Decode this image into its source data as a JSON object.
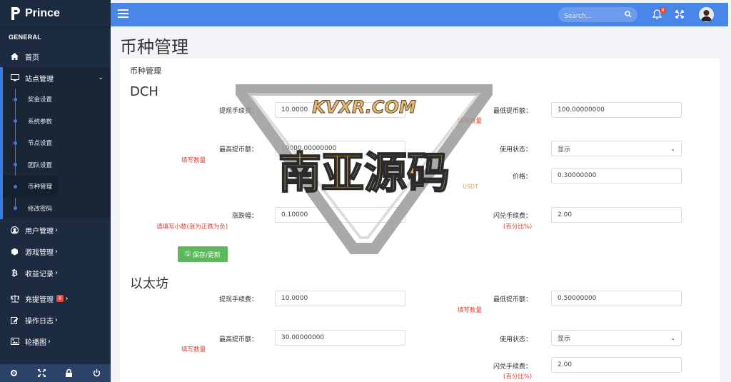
{
  "brand": {
    "name": "Prince"
  },
  "sidebar": {
    "section": "GENERAL",
    "home": "首页",
    "site_manage": "站点管理",
    "sub_items": [
      "奖金设置",
      "系统参数",
      "节点设置",
      "团队设置",
      "币种管理",
      "修改密码"
    ],
    "items": [
      {
        "label": "用户管理",
        "icon": "user-icon"
      },
      {
        "label": "游戏管理",
        "icon": "cube-icon"
      },
      {
        "label": "收益记录",
        "icon": "bitcoin-icon"
      },
      {
        "label": "充提管理",
        "icon": "scale-icon",
        "badge": "8"
      },
      {
        "label": "操作日志",
        "icon": "edit-icon"
      },
      {
        "label": "轮播图",
        "icon": "image-icon"
      }
    ]
  },
  "topbar": {
    "search_placeholder": "Search...",
    "notifications": "8"
  },
  "page": {
    "title": "币种管理",
    "card_title": "币种管理"
  },
  "coins": [
    {
      "name": "DCH",
      "withdraw_fee_label": "提现手续费：",
      "withdraw_fee": "10.0000",
      "min_withdraw_label": "最低提币额：",
      "min_withdraw": "100.00000000",
      "max_withdraw_label": "最高提币额：",
      "max_withdraw": "10000.00000000",
      "status_label": "使用状态：",
      "status": "显示",
      "price_label": "价格：",
      "price": "0.30000000",
      "change_label": "涨跌幅：",
      "change": "0.10000",
      "swap_fee_label": "闪兑手续费：",
      "swap_fee": "2.00",
      "save_label": "保存/更新"
    },
    {
      "name": "以太坊",
      "withdraw_fee_label": "提现手续费：",
      "withdraw_fee": "10.0000",
      "min_withdraw_label": "最低提币额：",
      "min_withdraw": "0.50000000",
      "max_withdraw_label": "最高提币额：",
      "max_withdraw": "30.00000000",
      "status_label": "使用状态：",
      "status": "显示",
      "swap_fee_label": "闪兑手续费：",
      "swap_fee": "2.00"
    }
  ],
  "hints": {
    "fill_amount": "填写数量",
    "decimal": "请填写小数(涨为正跌为负)",
    "percent": "(百分比%)",
    "usdt": "USDT"
  },
  "watermark": {
    "line1": "KVXR.COM",
    "line2": "南亚源码"
  },
  "colors": {
    "sidebar": "#1d2b41",
    "topbar": "#4a86e8",
    "accent": "#3e7bd9",
    "save": "#5cb85c",
    "hint": "#e23b2e"
  }
}
